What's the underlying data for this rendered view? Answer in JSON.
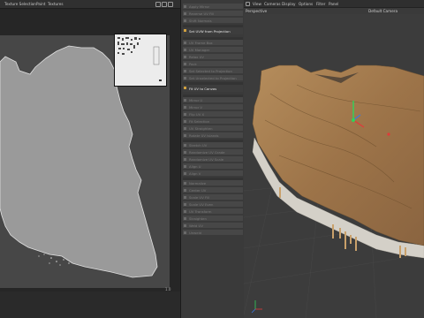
{
  "uv_panel": {
    "menu": [
      "Texture Selection",
      "Paint",
      "Textures"
    ],
    "corner_value": "1.0"
  },
  "commands": [
    {
      "label": "Apply Mirror",
      "active": false
    },
    {
      "label": "Reverse UV Fill",
      "active": false
    },
    {
      "label": "Shift Normals",
      "active": false
    },
    {
      "label": "Set UVW from Projection",
      "active": true
    },
    {
      "label": "UV Frame Box",
      "active": false
    },
    {
      "label": "UV Manager",
      "active": false
    },
    {
      "label": "Relax UV",
      "active": false
    },
    {
      "label": "Pack",
      "active": false
    },
    {
      "label": "Set Selected to Projection",
      "active": false
    },
    {
      "label": "Set Unselected to Projection",
      "active": false
    },
    {
      "label": "Fit UV to Canvas",
      "active": true
    },
    {
      "label": "Mirror U",
      "active": false
    },
    {
      "label": "Mirror V",
      "active": false
    },
    {
      "label": "Flip UV X",
      "active": false
    },
    {
      "label": "Fit Selection",
      "active": false
    },
    {
      "label": "UV Straighten",
      "active": false
    },
    {
      "label": "Rotate UV Islands",
      "active": false
    },
    {
      "label": "Stretch UV",
      "active": false
    },
    {
      "label": "Randomize UV Grade",
      "active": false
    },
    {
      "label": "Randomize UV Scale",
      "active": false
    },
    {
      "label": "Align U",
      "active": false
    },
    {
      "label": "Align V",
      "active": false
    },
    {
      "label": "Normalize",
      "active": false
    },
    {
      "label": "Center UV",
      "active": false
    },
    {
      "label": "Scale UV Fill",
      "active": false
    },
    {
      "label": "Scale UV Even",
      "active": false
    },
    {
      "label": "UV Transform",
      "active": false
    },
    {
      "label": "Straighten",
      "active": false
    },
    {
      "label": "Weld UV",
      "active": false
    },
    {
      "label": "Unweld",
      "active": false
    }
  ],
  "viewport": {
    "menu": [
      "View",
      "Cameras",
      "Display",
      "Options",
      "Filter",
      "Panel"
    ],
    "view_label": "Perspective",
    "camera_label": "Default Camera"
  },
  "colors": {
    "uv_background": "#474747",
    "uv_island": "#9a9a9a",
    "terrain_top": "#a07a50",
    "terrain_side": "#d8d4cc"
  }
}
